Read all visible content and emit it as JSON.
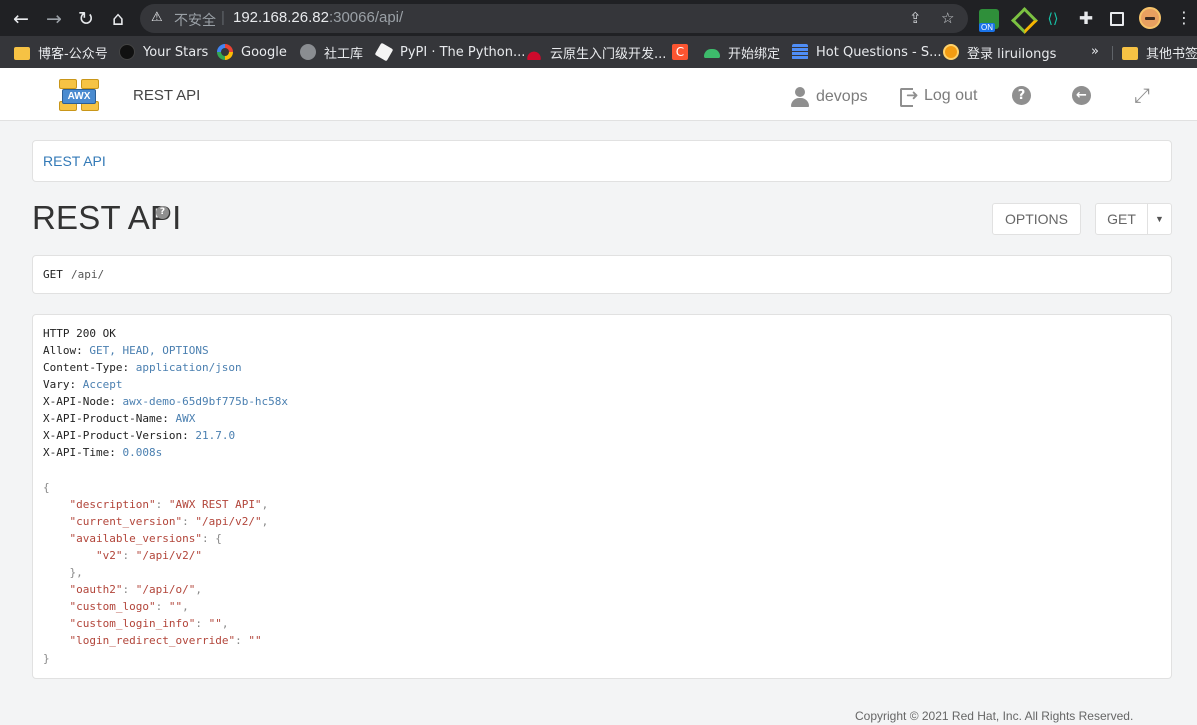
{
  "browser": {
    "security_label": "不安全",
    "url_host": "192.168.26.82",
    "url_rest": ":30066/api/",
    "extension_badge": "ON",
    "bookmarks": [
      {
        "label": "博客-公众号",
        "icon": "folder-icon"
      },
      {
        "label": "Your Stars",
        "icon": "github-icon"
      },
      {
        "label": "Google",
        "icon": "google-icon"
      },
      {
        "label": "社工库",
        "icon": "globe-icon"
      },
      {
        "label": "PyPI · The Python...",
        "icon": "pypi-icon"
      },
      {
        "label": "云原生入门级开发...",
        "icon": "huawei-icon"
      },
      {
        "label": "",
        "icon": "csdn-icon"
      },
      {
        "label": "开始绑定",
        "icon": "cloud-icon"
      },
      {
        "label": "Hot Questions - S...",
        "icon": "stack-icon"
      },
      {
        "label": "登录 liruilongs",
        "icon": "star-icon"
      }
    ],
    "bookmarks_more": "»",
    "other_bookmarks": "其他书签",
    "csdn_letter": "C"
  },
  "app": {
    "logo_text": "AWX",
    "title": "REST API",
    "user": "devops",
    "logout": "Log out",
    "help_icon_glyph": "?",
    "back_icon_glyph": "←",
    "expand_icon_glyph": "⤢"
  },
  "breadcrumb": "REST API",
  "page": {
    "title": "REST API",
    "help_glyph": "?",
    "options_button": "OPTIONS",
    "get_button": "GET",
    "caret": "▼"
  },
  "request": {
    "method": "GET",
    "path": "/api/"
  },
  "response": {
    "status": "HTTP 200 OK",
    "headers": [
      {
        "name": "Allow:",
        "value": "GET, HEAD, OPTIONS"
      },
      {
        "name": "Content-Type:",
        "value": "application/json"
      },
      {
        "name": "Vary:",
        "value": "Accept"
      },
      {
        "name": "X-API-Node:",
        "value": "awx-demo-65d9bf775b-hc58x"
      },
      {
        "name": "X-API-Product-Name:",
        "value": "AWX"
      },
      {
        "name": "X-API-Product-Version:",
        "value": "21.7.0"
      },
      {
        "name": "X-API-Time:",
        "value": "0.008s"
      }
    ],
    "body_lines": [
      {
        "indent": "",
        "key": "",
        "sep": "",
        "val": "",
        "punct": "{"
      },
      {
        "indent": "    ",
        "key": "\"description\"",
        "sep": ": ",
        "val": "\"AWX REST API\"",
        "punct": ","
      },
      {
        "indent": "    ",
        "key": "\"current_version\"",
        "sep": ": ",
        "val": "\"/api/v2/\"",
        "punct": ","
      },
      {
        "indent": "    ",
        "key": "\"available_versions\"",
        "sep": ": ",
        "val": "",
        "punct": "{"
      },
      {
        "indent": "        ",
        "key": "\"v2\"",
        "sep": ": ",
        "val": "\"/api/v2/\"",
        "punct": ""
      },
      {
        "indent": "    ",
        "key": "",
        "sep": "",
        "val": "",
        "punct": "},"
      },
      {
        "indent": "    ",
        "key": "\"oauth2\"",
        "sep": ": ",
        "val": "\"/api/o/\"",
        "punct": ","
      },
      {
        "indent": "    ",
        "key": "\"custom_logo\"",
        "sep": ": ",
        "val": "\"\"",
        "punct": ","
      },
      {
        "indent": "    ",
        "key": "\"custom_login_info\"",
        "sep": ": ",
        "val": "\"\"",
        "punct": ","
      },
      {
        "indent": "    ",
        "key": "\"login_redirect_override\"",
        "sep": ": ",
        "val": "\"\"",
        "punct": ""
      },
      {
        "indent": "",
        "key": "",
        "sep": "",
        "val": "",
        "punct": "}"
      }
    ]
  },
  "footer": "Copyright © 2021 Red Hat, Inc. All Rights Reserved."
}
